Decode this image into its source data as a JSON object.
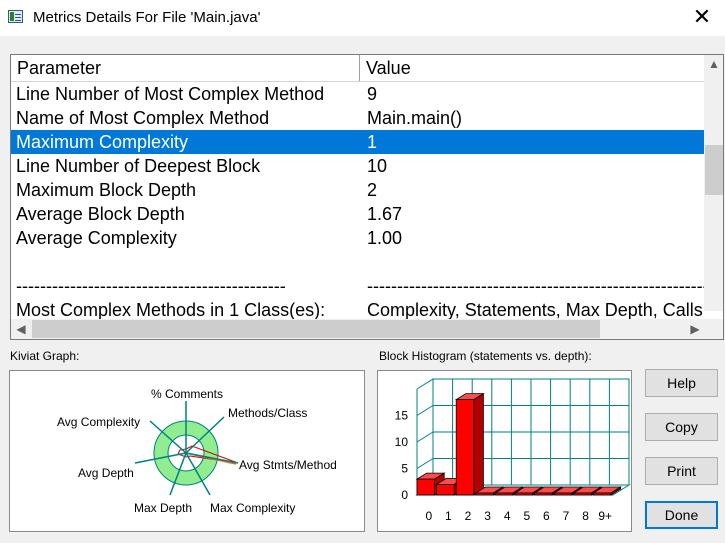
{
  "window": {
    "title": "Metrics Details For File 'Main.java'",
    "close_glyph": "✕"
  },
  "table": {
    "headers": [
      "Parameter",
      "Value"
    ],
    "rows": [
      [
        "Line Number of Most Complex Method",
        "9"
      ],
      [
        "Name of Most Complex Method",
        "Main.main()"
      ],
      [
        "Maximum Complexity",
        "1"
      ],
      [
        "Line Number of Deepest Block",
        "10"
      ],
      [
        "Maximum Block Depth",
        "2"
      ],
      [
        "Average Block Depth",
        "1.67"
      ],
      [
        "Average Complexity",
        "1.00"
      ],
      [
        "",
        ""
      ],
      [
        "---------------------------------------------",
        "----------------------------------------------------------"
      ],
      [
        "Most Complex Methods in 1 Class(es):",
        "Complexity, Statements, Max Depth, Calls"
      ]
    ],
    "selected_row": 2
  },
  "kiviat": {
    "label": "Kiviat Graph:",
    "axes": [
      "% Comments",
      "Methods/Class",
      "Avg Stmts/Method",
      "Max Complexity",
      "Max Depth",
      "Avg Depth",
      "Avg Complexity"
    ]
  },
  "histogram": {
    "label": "Block Histogram (statements vs. depth):",
    "y_ticks": [
      "15",
      "10",
      "5",
      "0"
    ],
    "categories": [
      "0",
      "1",
      "2",
      "3",
      "4",
      "5",
      "6",
      "7",
      "8",
      "9+"
    ],
    "values": [
      3,
      2,
      18,
      0,
      0,
      0,
      0,
      0,
      0,
      0
    ],
    "ylim": [
      0,
      20
    ],
    "bar_color": "#ff0000",
    "grid_color": "#008080"
  },
  "buttons": {
    "help": "Help",
    "copy": "Copy",
    "print": "Print",
    "done": "Done"
  }
}
